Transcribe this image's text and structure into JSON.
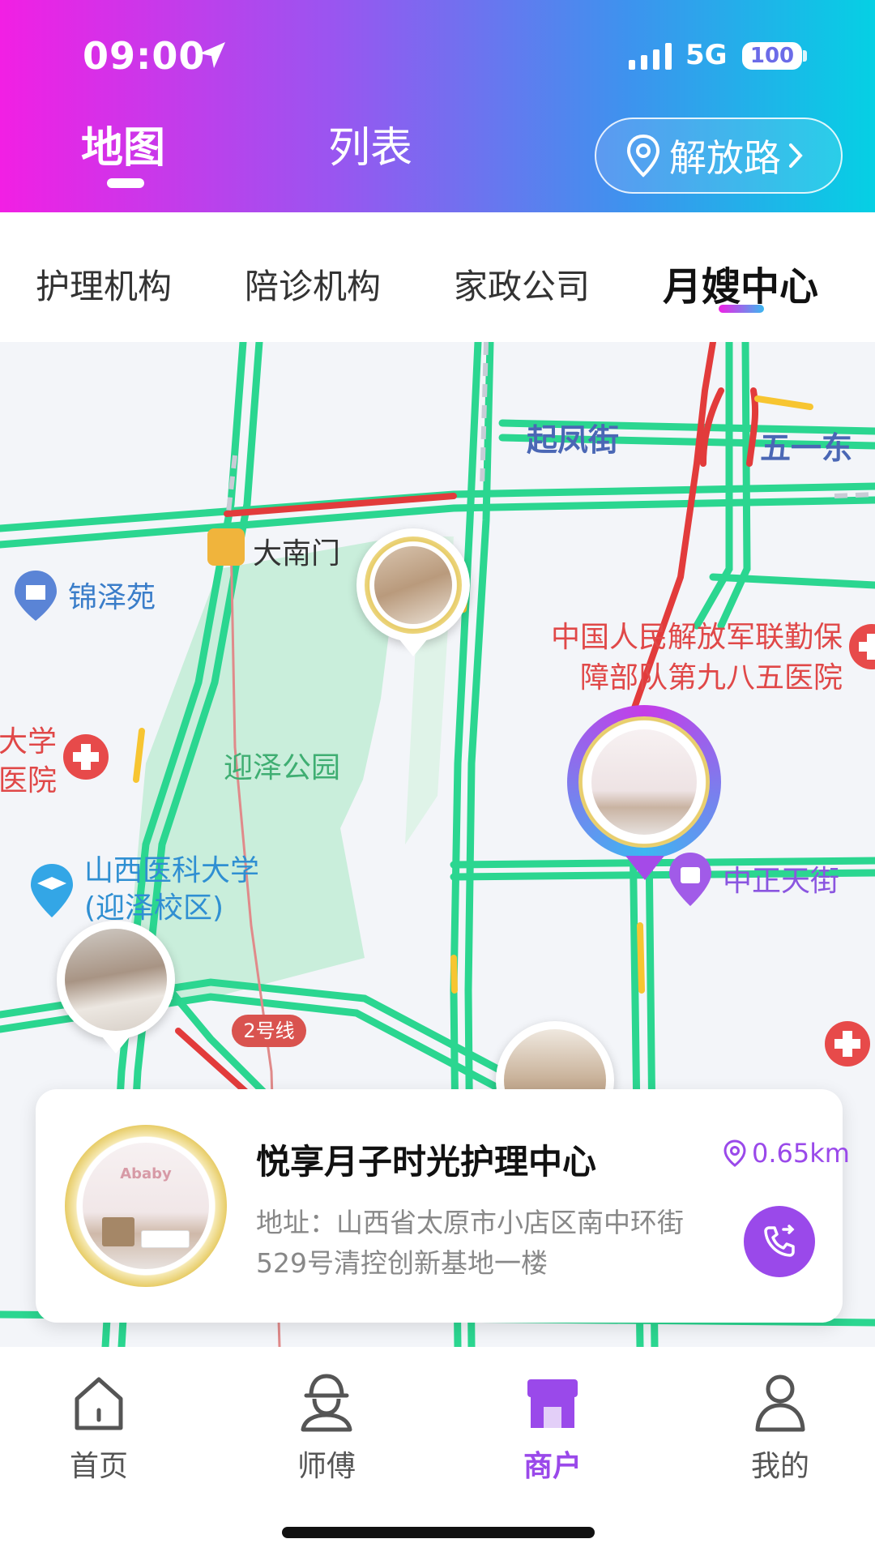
{
  "status_bar": {
    "time": "09:00",
    "network": "5G",
    "battery": "100"
  },
  "header": {
    "view_tabs": [
      {
        "label": "地图",
        "active": true
      },
      {
        "label": "列表",
        "active": false
      }
    ],
    "location": {
      "label": "解放路",
      "icon": "location-pin-icon"
    }
  },
  "categories": [
    {
      "label": "护理机构",
      "active": false
    },
    {
      "label": "陪诊机构",
      "active": false
    },
    {
      "label": "家政公司",
      "active": false
    },
    {
      "label": "月嫂中心",
      "active": true
    }
  ],
  "map": {
    "streets": [
      "起凤街",
      "五一东"
    ],
    "pois": {
      "damenmen": "大南门",
      "jinzeyuan": "锦泽苑",
      "hospital": [
        "中国人民解放军联勤保",
        "障部队第九八五医院"
      ],
      "park": "迎泽公园",
      "university_hospital": [
        "大学",
        "医院"
      ],
      "university": [
        "山西医科大学",
        "(迎泽校区)"
      ],
      "mall": "中正天街"
    },
    "metro_line": "2号线",
    "colors": {
      "road_green": "#2bd690",
      "road_red": "#e23b3b",
      "road_yellow": "#f7c531",
      "park": "#c9eedb"
    }
  },
  "merchant_card": {
    "name": "悦享月子时光护理中心",
    "distance": "0.65km",
    "address": "地址：山西省太原市小店区南中环街529号清控创新基地一楼",
    "logo_text": "Ababy",
    "call_icon": "phone-transfer-icon"
  },
  "bottom_nav": [
    {
      "label": "首页",
      "icon": "home-icon",
      "active": false
    },
    {
      "label": "师傅",
      "icon": "worker-icon",
      "active": false
    },
    {
      "label": "商户",
      "icon": "store-icon",
      "active": true
    },
    {
      "label": "我的",
      "icon": "user-icon",
      "active": false
    }
  ],
  "theme": {
    "accent": "#9a49ea",
    "gradient_start": "#f21fe4",
    "gradient_end": "#05d0e4"
  }
}
